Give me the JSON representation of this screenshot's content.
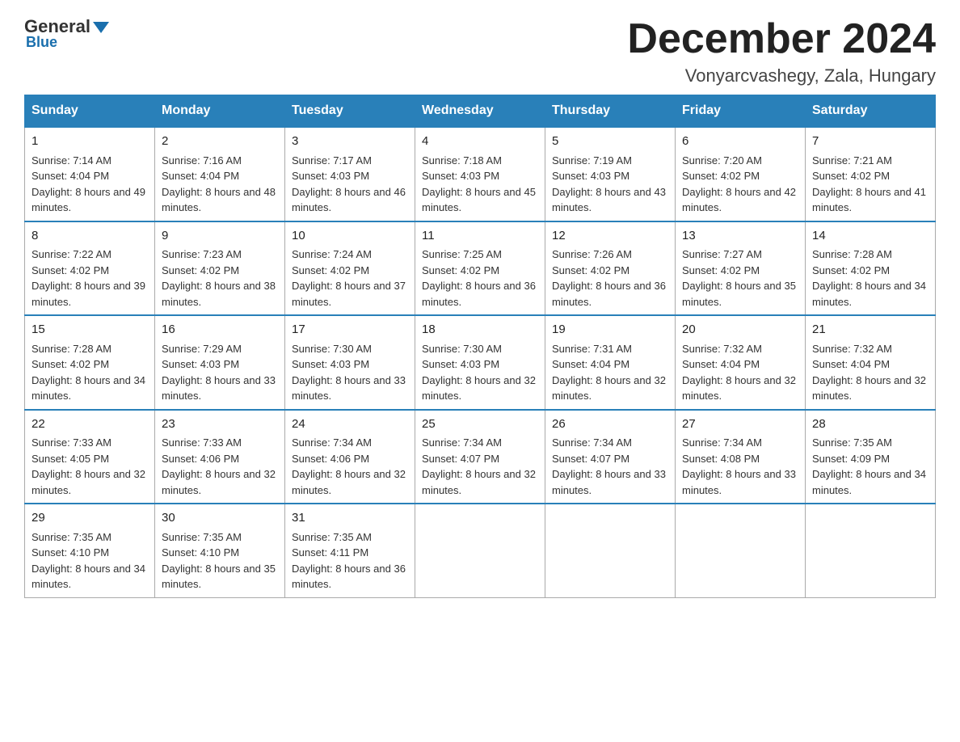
{
  "header": {
    "logo": {
      "general": "General",
      "blue": "Blue"
    },
    "title": "December 2024",
    "location": "Vonyarcvashegy, Zala, Hungary"
  },
  "days_of_week": [
    "Sunday",
    "Monday",
    "Tuesday",
    "Wednesday",
    "Thursday",
    "Friday",
    "Saturday"
  ],
  "weeks": [
    [
      {
        "day": "1",
        "sunrise": "7:14 AM",
        "sunset": "4:04 PM",
        "daylight": "8 hours and 49 minutes."
      },
      {
        "day": "2",
        "sunrise": "7:16 AM",
        "sunset": "4:04 PM",
        "daylight": "8 hours and 48 minutes."
      },
      {
        "day": "3",
        "sunrise": "7:17 AM",
        "sunset": "4:03 PM",
        "daylight": "8 hours and 46 minutes."
      },
      {
        "day": "4",
        "sunrise": "7:18 AM",
        "sunset": "4:03 PM",
        "daylight": "8 hours and 45 minutes."
      },
      {
        "day": "5",
        "sunrise": "7:19 AM",
        "sunset": "4:03 PM",
        "daylight": "8 hours and 43 minutes."
      },
      {
        "day": "6",
        "sunrise": "7:20 AM",
        "sunset": "4:02 PM",
        "daylight": "8 hours and 42 minutes."
      },
      {
        "day": "7",
        "sunrise": "7:21 AM",
        "sunset": "4:02 PM",
        "daylight": "8 hours and 41 minutes."
      }
    ],
    [
      {
        "day": "8",
        "sunrise": "7:22 AM",
        "sunset": "4:02 PM",
        "daylight": "8 hours and 39 minutes."
      },
      {
        "day": "9",
        "sunrise": "7:23 AM",
        "sunset": "4:02 PM",
        "daylight": "8 hours and 38 minutes."
      },
      {
        "day": "10",
        "sunrise": "7:24 AM",
        "sunset": "4:02 PM",
        "daylight": "8 hours and 37 minutes."
      },
      {
        "day": "11",
        "sunrise": "7:25 AM",
        "sunset": "4:02 PM",
        "daylight": "8 hours and 36 minutes."
      },
      {
        "day": "12",
        "sunrise": "7:26 AM",
        "sunset": "4:02 PM",
        "daylight": "8 hours and 36 minutes."
      },
      {
        "day": "13",
        "sunrise": "7:27 AM",
        "sunset": "4:02 PM",
        "daylight": "8 hours and 35 minutes."
      },
      {
        "day": "14",
        "sunrise": "7:28 AM",
        "sunset": "4:02 PM",
        "daylight": "8 hours and 34 minutes."
      }
    ],
    [
      {
        "day": "15",
        "sunrise": "7:28 AM",
        "sunset": "4:02 PM",
        "daylight": "8 hours and 34 minutes."
      },
      {
        "day": "16",
        "sunrise": "7:29 AM",
        "sunset": "4:03 PM",
        "daylight": "8 hours and 33 minutes."
      },
      {
        "day": "17",
        "sunrise": "7:30 AM",
        "sunset": "4:03 PM",
        "daylight": "8 hours and 33 minutes."
      },
      {
        "day": "18",
        "sunrise": "7:30 AM",
        "sunset": "4:03 PM",
        "daylight": "8 hours and 32 minutes."
      },
      {
        "day": "19",
        "sunrise": "7:31 AM",
        "sunset": "4:04 PM",
        "daylight": "8 hours and 32 minutes."
      },
      {
        "day": "20",
        "sunrise": "7:32 AM",
        "sunset": "4:04 PM",
        "daylight": "8 hours and 32 minutes."
      },
      {
        "day": "21",
        "sunrise": "7:32 AM",
        "sunset": "4:04 PM",
        "daylight": "8 hours and 32 minutes."
      }
    ],
    [
      {
        "day": "22",
        "sunrise": "7:33 AM",
        "sunset": "4:05 PM",
        "daylight": "8 hours and 32 minutes."
      },
      {
        "day": "23",
        "sunrise": "7:33 AM",
        "sunset": "4:06 PM",
        "daylight": "8 hours and 32 minutes."
      },
      {
        "day": "24",
        "sunrise": "7:34 AM",
        "sunset": "4:06 PM",
        "daylight": "8 hours and 32 minutes."
      },
      {
        "day": "25",
        "sunrise": "7:34 AM",
        "sunset": "4:07 PM",
        "daylight": "8 hours and 32 minutes."
      },
      {
        "day": "26",
        "sunrise": "7:34 AM",
        "sunset": "4:07 PM",
        "daylight": "8 hours and 33 minutes."
      },
      {
        "day": "27",
        "sunrise": "7:34 AM",
        "sunset": "4:08 PM",
        "daylight": "8 hours and 33 minutes."
      },
      {
        "day": "28",
        "sunrise": "7:35 AM",
        "sunset": "4:09 PM",
        "daylight": "8 hours and 34 minutes."
      }
    ],
    [
      {
        "day": "29",
        "sunrise": "7:35 AM",
        "sunset": "4:10 PM",
        "daylight": "8 hours and 34 minutes."
      },
      {
        "day": "30",
        "sunrise": "7:35 AM",
        "sunset": "4:10 PM",
        "daylight": "8 hours and 35 minutes."
      },
      {
        "day": "31",
        "sunrise": "7:35 AM",
        "sunset": "4:11 PM",
        "daylight": "8 hours and 36 minutes."
      },
      null,
      null,
      null,
      null
    ]
  ]
}
